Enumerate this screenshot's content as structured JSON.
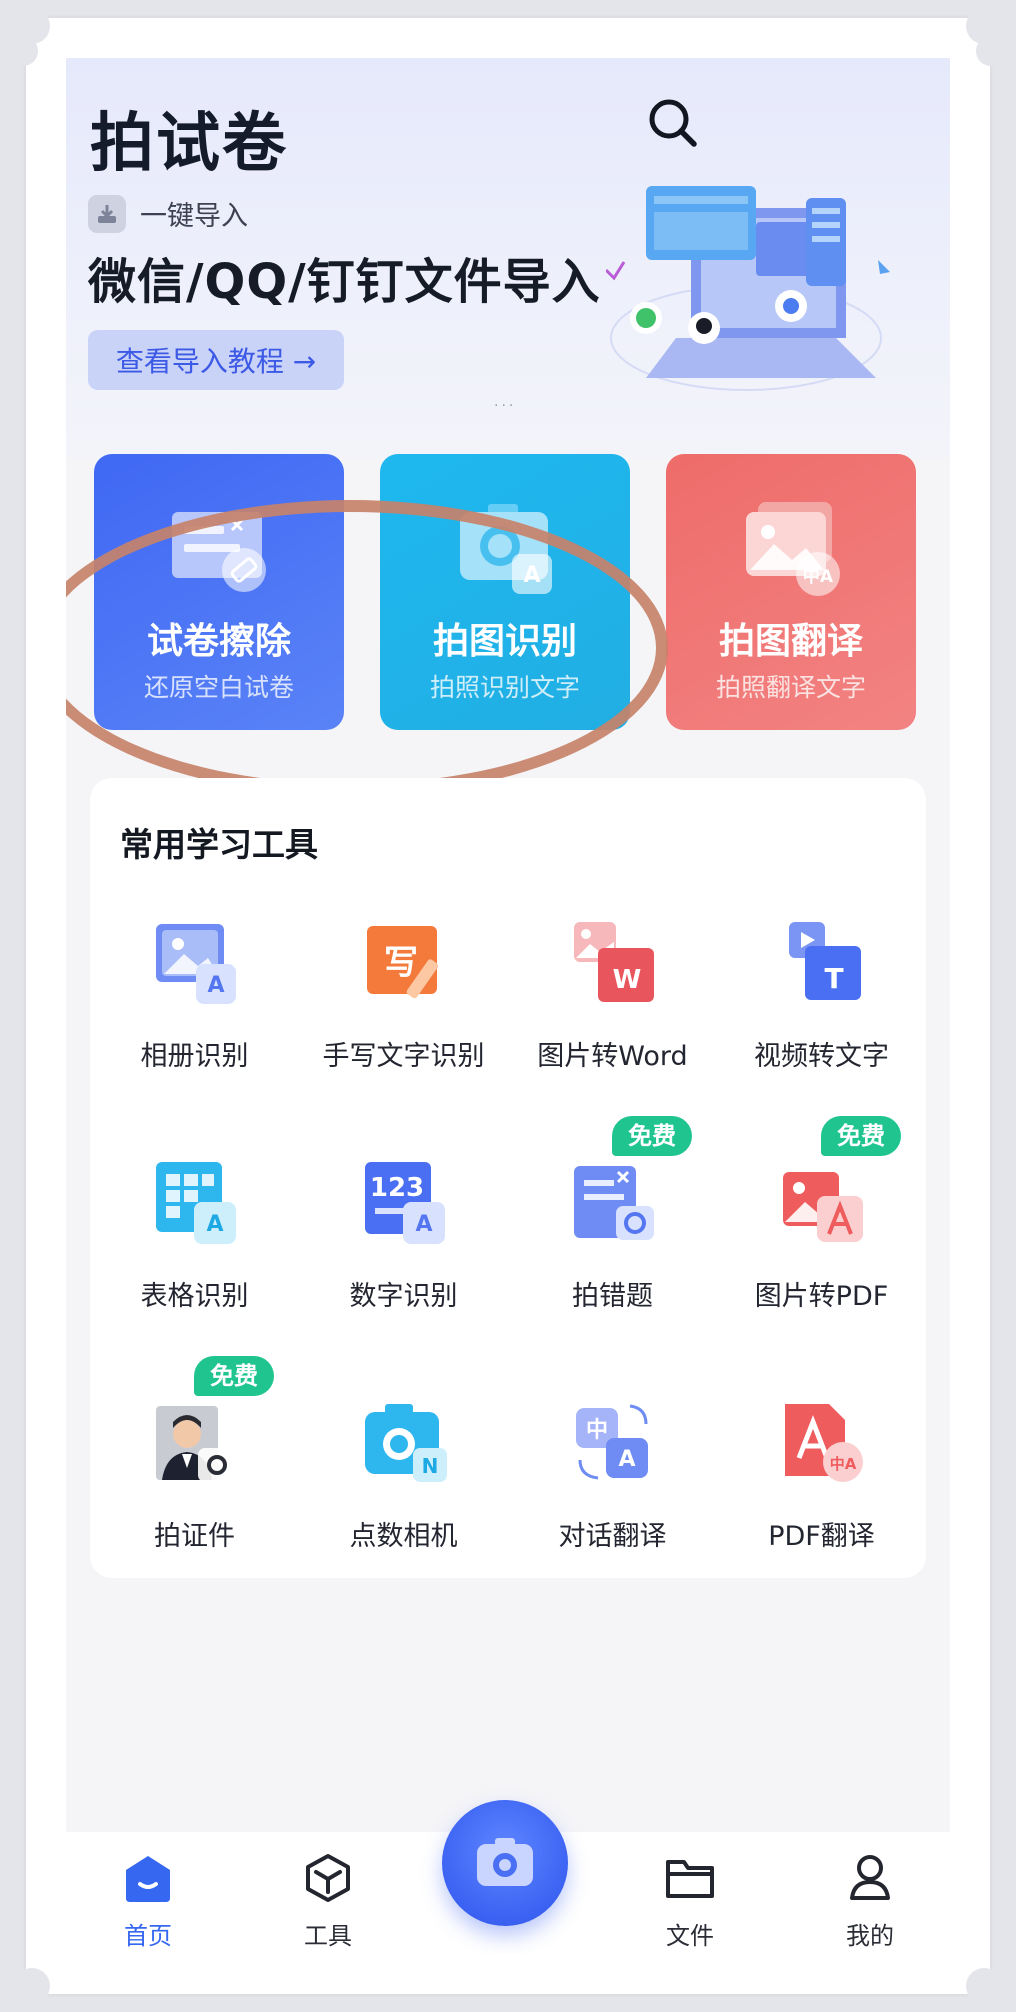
{
  "header": {
    "app_title": "拍试卷",
    "import_subtitle": "一键导入",
    "import_title": "微信/QQ/钉钉文件导入",
    "tutorial_button": "查看导入教程 →"
  },
  "feature_cards": [
    {
      "title": "试卷擦除",
      "subtitle": "还原空白试卷",
      "icon": "eraser-paper-icon",
      "color": "#4a72f5"
    },
    {
      "title": "拍图识别",
      "subtitle": "拍照识别文字",
      "icon": "camera-scan-icon",
      "color": "#1fb4ec"
    },
    {
      "title": "拍图翻译",
      "subtitle": "拍照翻译文字",
      "icon": "image-translate-icon",
      "color": "#ef7472"
    }
  ],
  "tools": {
    "title": "常用学习工具",
    "badge_text": "免费",
    "items": [
      {
        "label": "相册识别",
        "icon": "album-ocr-icon"
      },
      {
        "label": "手写文字识别",
        "icon": "handwriting-icon"
      },
      {
        "label": "图片转Word",
        "icon": "image-to-word-icon"
      },
      {
        "label": "视频转文字",
        "icon": "video-to-text-icon"
      },
      {
        "label": "表格识别",
        "icon": "table-ocr-icon"
      },
      {
        "label": "数字识别",
        "icon": "number-ocr-icon"
      },
      {
        "label": "拍错题",
        "icon": "wrong-question-icon",
        "free": true
      },
      {
        "label": "图片转PDF",
        "icon": "image-to-pdf-icon",
        "free": true
      },
      {
        "label": "拍证件",
        "icon": "id-photo-icon",
        "free": true
      },
      {
        "label": "点数相机",
        "icon": "count-camera-icon"
      },
      {
        "label": "对话翻译",
        "icon": "dialog-translate-icon"
      },
      {
        "label": "PDF翻译",
        "icon": "pdf-translate-icon"
      }
    ]
  },
  "bottom_nav": {
    "items": [
      {
        "label": "首页",
        "icon": "home-icon",
        "active": true
      },
      {
        "label": "工具",
        "icon": "tools-cube-icon"
      },
      {
        "label": "文件",
        "icon": "folder-icon"
      },
      {
        "label": "我的",
        "icon": "profile-icon"
      }
    ],
    "center_button_icon": "camera-icon"
  },
  "colors": {
    "primary": "#3567f0",
    "free_badge": "#1fc48f",
    "annotation": "#c7826a"
  }
}
